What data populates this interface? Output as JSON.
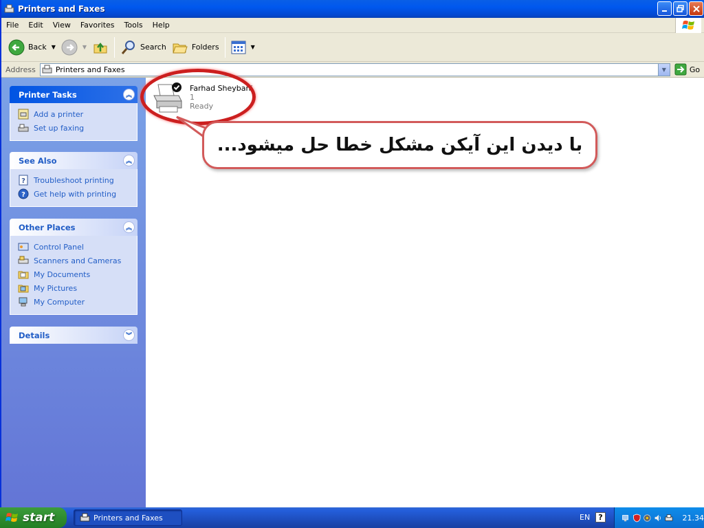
{
  "window": {
    "title": "Printers and Faxes",
    "buttons": [
      "minimize",
      "maximize",
      "close"
    ]
  },
  "menu": [
    "File",
    "Edit",
    "View",
    "Favorites",
    "Tools",
    "Help"
  ],
  "toolbar": {
    "back_label": "Back",
    "search_label": "Search",
    "folders_label": "Folders"
  },
  "address": {
    "label": "Address",
    "value": "Printers and Faxes",
    "go_label": "Go"
  },
  "sidebar": {
    "printer_tasks": {
      "title": "Printer Tasks",
      "items": [
        {
          "label": "Add a printer",
          "icon": "add-printer-icon"
        },
        {
          "label": "Set up faxing",
          "icon": "fax-icon"
        }
      ]
    },
    "see_also": {
      "title": "See Also",
      "items": [
        {
          "label": "Troubleshoot printing",
          "icon": "help-book-icon"
        },
        {
          "label": "Get help with printing",
          "icon": "help-icon"
        }
      ]
    },
    "other_places": {
      "title": "Other Places",
      "items": [
        {
          "label": "Control Panel",
          "icon": "control-panel-icon"
        },
        {
          "label": "Scanners and Cameras",
          "icon": "scanner-icon"
        },
        {
          "label": "My Documents",
          "icon": "folder-icon"
        },
        {
          "label": "My Pictures",
          "icon": "pictures-folder-icon"
        },
        {
          "label": "My Computer",
          "icon": "computer-icon"
        }
      ]
    },
    "details": {
      "title": "Details"
    }
  },
  "content": {
    "printer": {
      "name": "Farhad Sheybani",
      "documents": "1",
      "status": "Ready"
    },
    "callout": "با دیدن این آیکن مشکل خطا حل میشود..."
  },
  "taskbar": {
    "start_label": "start",
    "window_button": "Printers and Faxes",
    "language": "EN",
    "help": "?",
    "clock": "21.34"
  },
  "colors": {
    "titlebar": "#0058ee",
    "sidebar": "#6375d6",
    "link": "#215dc6",
    "highlight": "#cc1f1f",
    "start": "#2f8c2f"
  }
}
